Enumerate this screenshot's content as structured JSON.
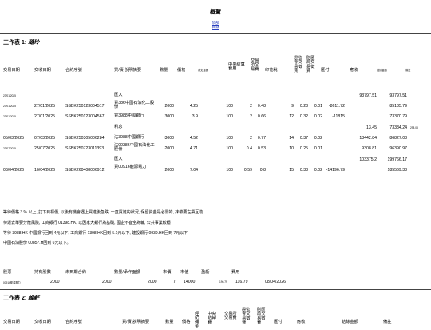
{
  "title": "概覽",
  "top_link": [
    "頂部",
    "目錄"
  ],
  "sheet1": {
    "heading_prefix": "工作表 1:",
    "heading_name": "璐玲",
    "headers": {
      "trade_date": "交易日期",
      "settle_date": "交收日期",
      "contract": "合約序號",
      "desc": "買/賣 說明摘要",
      "qty": "數量",
      "price": "價格",
      "tiny_col": "成交金額",
      "levy": "中央結算費用",
      "exch_fee": "交易所交易費",
      "stamp": "印花稅",
      "sfc_levy": "證監會交易徵費",
      "frc_levy": "財匯局交易徵費",
      "remit": "匯付",
      "receipt": "應收",
      "balance_small": "結餘金額",
      "memo_small": "備註"
    },
    "rows": [
      {
        "trade_date": "23/01/2025",
        "settle_date": "",
        "contract": "",
        "desc": "匯入",
        "qty": "",
        "price": "",
        "levy": "",
        "exch": "",
        "stamp": "",
        "sfc": "",
        "frc": "",
        "remit": "",
        "receipt": "93797.51",
        "balance": "93797.51",
        "extra": "",
        "small_date": true
      },
      {
        "trade_date": "23/01/2025",
        "settle_date": "27/01/2025",
        "contract": "SSBK250123004517",
        "desc": "買386中國石油化工股份",
        "qty": "2000",
        "price": "4.25",
        "levy": "100",
        "exch": "2",
        "stamp": "0.48",
        "sfc": "9",
        "frc": "0.23",
        "frc2": "0.01",
        "remit": "-8611.72",
        "receipt": "",
        "balance": "85185.79",
        "extra": "",
        "small_date": true
      },
      {
        "trade_date": "23/01/2025",
        "settle_date": "27/01/2025",
        "contract": "SSBK250123004567",
        "desc": "買3988中國銀行",
        "qty": "3000",
        "price": "3.9",
        "levy": "100",
        "exch": "2",
        "stamp": "0.66",
        "sfc": "12",
        "frc": "0.32",
        "frc2": "0.02",
        "remit": "-11815",
        "receipt": "",
        "balance": "73370.79",
        "extra": "",
        "small_date": true
      },
      {
        "trade_date": "",
        "settle_date": "",
        "contract": "",
        "desc": "利息",
        "qty": "",
        "price": "",
        "levy": "",
        "exch": "",
        "stamp": "",
        "sfc": "",
        "frc": "",
        "remit": "",
        "receipt": "13.45",
        "balance": "73384.24",
        "extra": "298.08",
        "small_date": false
      },
      {
        "trade_date": "05/03/2025",
        "settle_date": "07/03/2025",
        "contract": "SSBK250305006284",
        "desc": "沽3988中國銀行",
        "qty": "-3000",
        "price": "4.52",
        "levy": "100",
        "exch": "2",
        "stamp": "0.77",
        "sfc": "14",
        "frc": "0.37",
        "frc2": "0.02",
        "remit": "",
        "receipt": "13442.84",
        "balance": "86827.08",
        "extra": "",
        "small_date": false
      },
      {
        "trade_date": "23/07/2025",
        "settle_date": "25/07/2025",
        "contract": "SSBK250723011393",
        "desc": "沽00386中國石油化工股份",
        "qty": "-2000",
        "price": "4.71",
        "levy": "100",
        "exch": "0.4",
        "stamp": "0.53",
        "sfc": "10",
        "frc": "0.25",
        "frc2": "0.01",
        "remit": "",
        "receipt": "9308.81",
        "balance": "96390.97",
        "extra": "",
        "small_date": true
      },
      {
        "trade_date": "",
        "settle_date": "",
        "contract": "",
        "desc": "匯入",
        "qty": "",
        "price": "",
        "levy": "",
        "exch": "",
        "stamp": "",
        "sfc": "",
        "frc": "",
        "remit": "",
        "receipt": "103375.2",
        "balance": "199766.17",
        "extra": "",
        "small_date": false
      },
      {
        "trade_date": "08/04/2026",
        "settle_date": "10/04/2026",
        "contract": "SSBK260408006912",
        "desc": "買00916龍源電力",
        "qty": "2000",
        "price": "7.04",
        "levy": "100",
        "exch": "0.59",
        "stamp": "0.8",
        "sfc": "15",
        "frc": "0.38",
        "frc2": "0.02",
        "remit": "-14196.79",
        "receipt": "",
        "balance": "185569.38",
        "extra": "",
        "small_date": false
      }
    ],
    "notes": [
      "等待價格 3 % 以上, 訂下目標價, 以後有機會遇上買進後急跌, 一直買進的狀況, 保留資金是必需的, 抹帶要左攝互助",
      "待運去單要分散風險, 工商銀行 01398.HK, 以因家大銀行為基礎, 國企不宜全為輔, 公共事業較穩",
      "等待 3988.HK 中國銀行回到 4元以下, 工商銀行 1398.HK回到 5.1元以下, 建設銀行 0939.HK回到 7元以下",
      "中國石油股份 00857.H回到 6元以下。"
    ],
    "holdings_headers": [
      "股票",
      "持有股數",
      "未到期合約",
      "數量/承作面額",
      "市價",
      "市值",
      "盈虧",
      "費用"
    ],
    "holdings_row": {
      "name": "00916龍源電力",
      "shares": "2000",
      "pending": "2000",
      "qty": "2000",
      "price": "7",
      "value": "14000",
      "pnl": "-196.79",
      "fee": "116.79",
      "date": "08/04/2026"
    }
  },
  "sheet2": {
    "heading_prefix": "工作表 2:",
    "heading_name": "維軒",
    "headers": [
      "交易日期",
      "交收日期",
      "合約序號",
      "買/賣 說明摘要",
      "數量",
      "價格",
      "經紀佣金",
      "中央結算費",
      "交易所交易費",
      "證監會交易徵費",
      "財匯局交易徵費",
      "匯付",
      "應收",
      "結餘金額",
      "備註"
    ]
  }
}
